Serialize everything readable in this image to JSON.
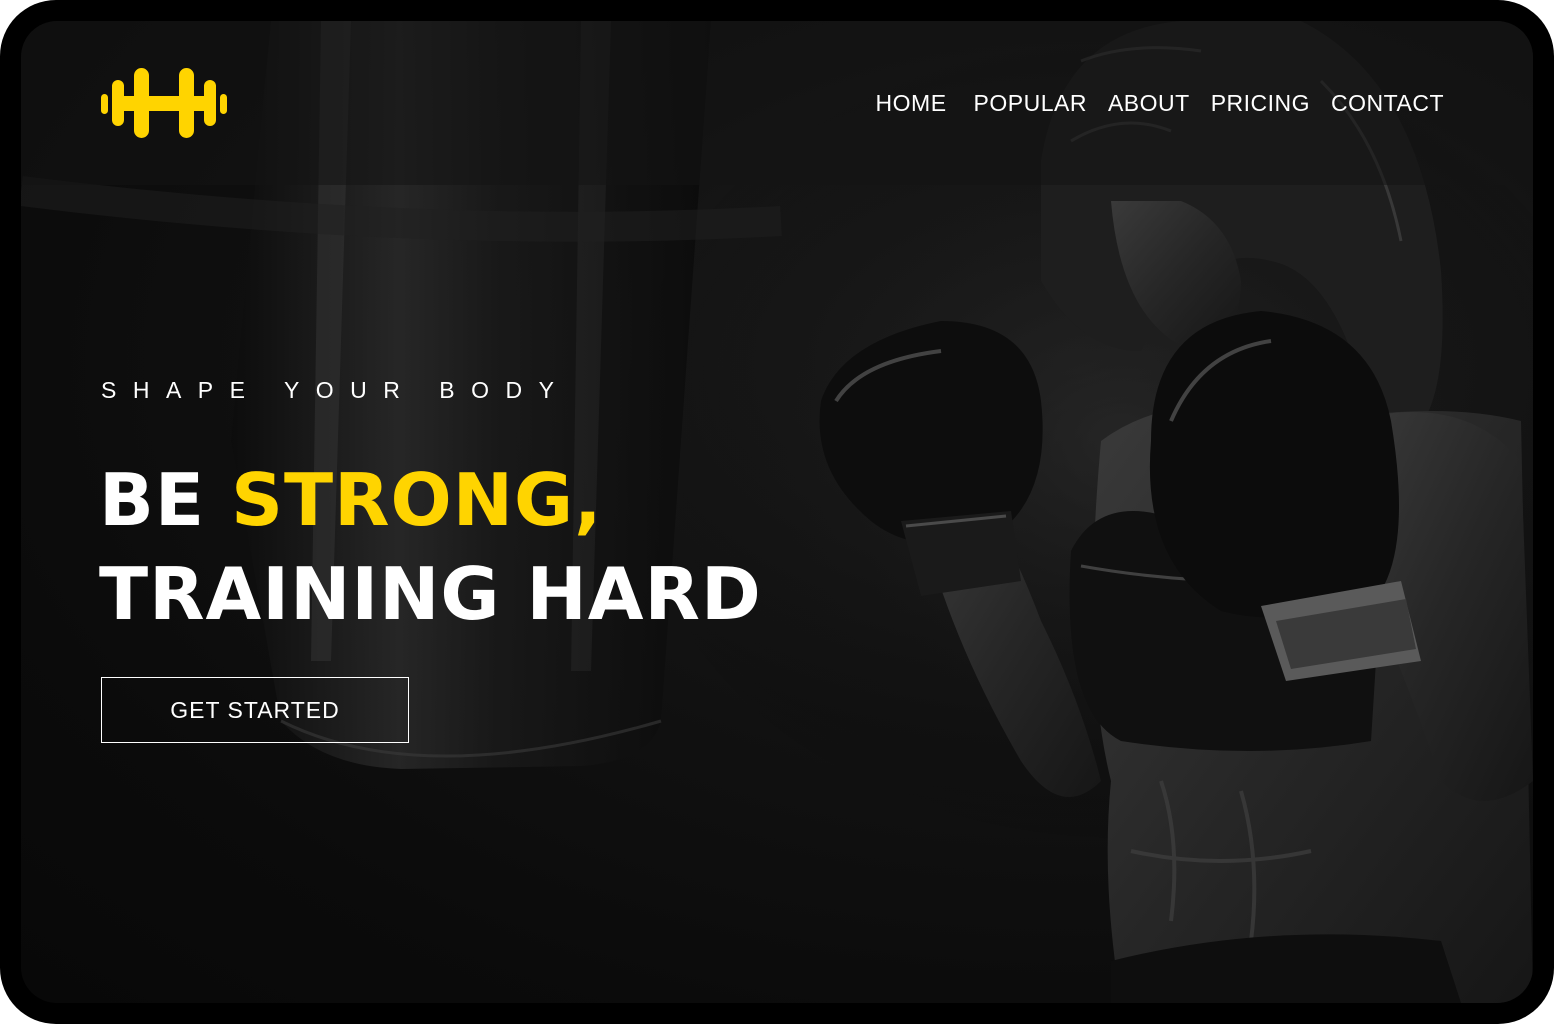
{
  "brand": {
    "logo_icon": "dumbbell-h-icon",
    "accent_color": "#ffd400"
  },
  "nav": {
    "items": [
      {
        "label": "HOME"
      },
      {
        "label": "POPULAR"
      },
      {
        "label": "ABOUT"
      },
      {
        "label": "PRICING"
      },
      {
        "label": "CONTACT"
      }
    ]
  },
  "hero": {
    "eyebrow": "SHAPE YOUR BODY",
    "headline_word1": "BE",
    "headline_accent": "STRONG,",
    "headline_line2": "TRAINING HARD",
    "cta_label": "GET STARTED",
    "background_image": "boxer-with-punching-bag"
  }
}
